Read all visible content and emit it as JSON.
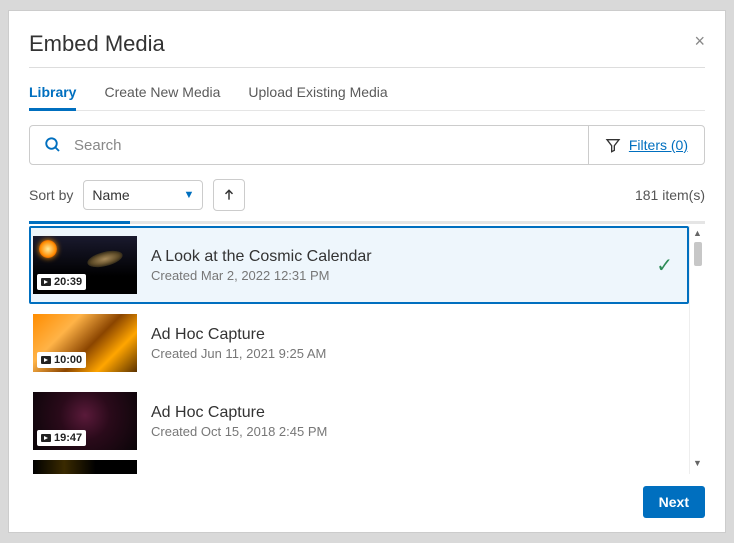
{
  "dialog": {
    "title": "Embed Media",
    "close_label": "×"
  },
  "tabs": {
    "library": "Library",
    "create": "Create New Media",
    "upload": "Upload Existing Media"
  },
  "search": {
    "placeholder": "Search",
    "filters_label": "Filters (0)"
  },
  "sort": {
    "label": "Sort by",
    "value": "Name",
    "count": "181 item(s)"
  },
  "items": [
    {
      "title": "A Look at the Cosmic Calendar",
      "sub": "Created Mar 2, 2022 12:31 PM",
      "dur": "20:39",
      "selected": true
    },
    {
      "title": "Ad Hoc Capture",
      "sub": "Created Jun 11, 2021 9:25 AM",
      "dur": "10:00",
      "selected": false
    },
    {
      "title": "Ad Hoc Capture",
      "sub": "Created Oct 15, 2018 2:45 PM",
      "dur": "19:47",
      "selected": false
    }
  ],
  "footer": {
    "next": "Next"
  }
}
